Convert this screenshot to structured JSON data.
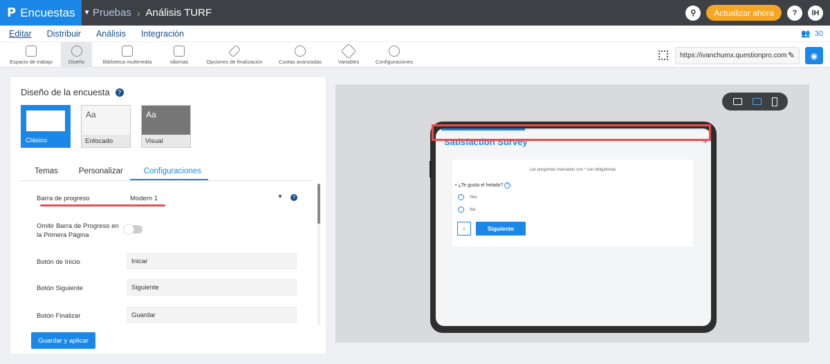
{
  "topbar": {
    "brand_logo": "P",
    "brand": "Encuestas",
    "crumb1": "Pruebas",
    "crumb2": "Análisis TURF",
    "upgrade": "Actualizar ahora",
    "help": "?",
    "initials": "IH"
  },
  "menu": {
    "items": [
      "Editar",
      "Distribuir",
      "Análisis",
      "Integración"
    ],
    "users": "30"
  },
  "toolbar": {
    "items": [
      "Espacio de trabajo",
      "Diseño",
      "Biblioteca multimedia",
      "Idiomas",
      "Opciones de finalización",
      "Cuotas avanzadas",
      "Variables",
      "Configuraciones"
    ],
    "url": "https://ivanchumx.questionpro.com"
  },
  "panel": {
    "title": "Diseño de la encuesta",
    "themes": [
      "Clásico",
      "Enfocado",
      "Visual"
    ],
    "tabs": [
      "Temas",
      "Personalizar",
      "Configuraciones"
    ]
  },
  "settings": {
    "progress_label": "Barra de progreso",
    "progress_value": "Modern 1",
    "omit_label1": "Omitir Barra de Progreso en",
    "omit_label2": "la Primera Página",
    "start_label": "Botón de Inicio",
    "start_value": "Inicar",
    "next_label": "Botón Siguiente",
    "next_value": "Siguiente",
    "finish_label": "Botón Finalizar",
    "finish_value": "Guardar",
    "save": "Guardar y aplicar"
  },
  "preview": {
    "title": "Satisfaction Survey",
    "required": "Las preguntas marcadas con * son obligatorias",
    "question": "• ¿Te gusta el helado?",
    "options": [
      "Yes",
      "No"
    ],
    "next": "Siguiente",
    "progress": 0.31
  }
}
